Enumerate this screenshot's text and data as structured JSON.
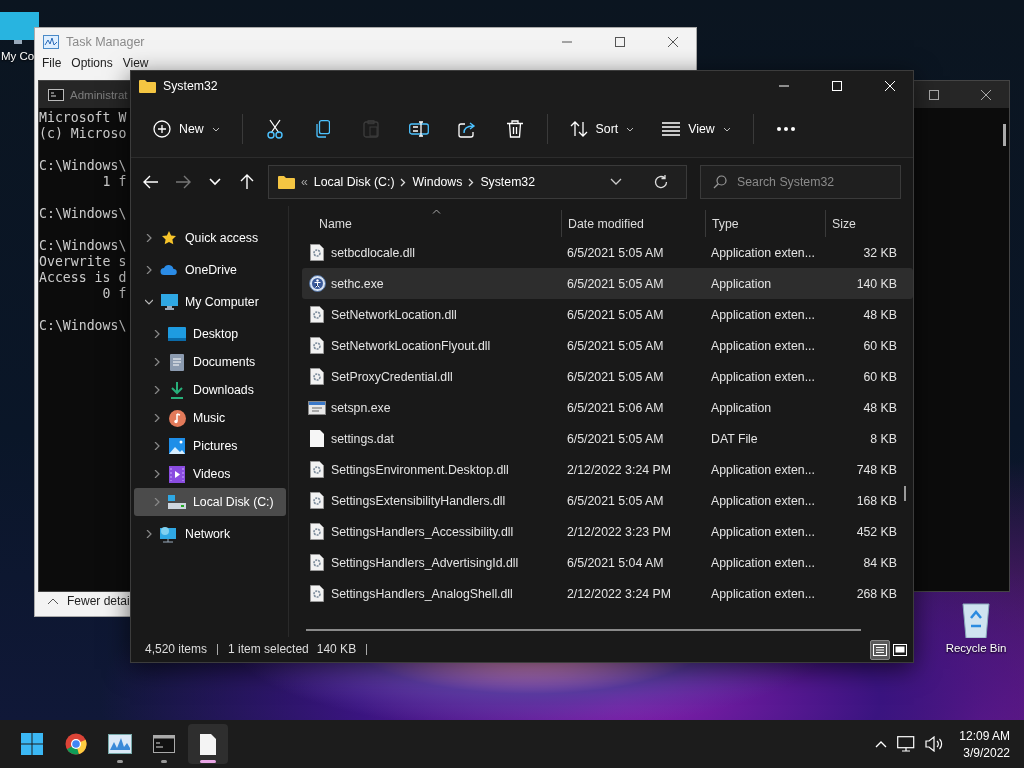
{
  "desktop_icons": [
    {
      "kind": "computer",
      "label": "My Co"
    },
    {
      "kind": "recycle_bin",
      "label": "Recycle Bin"
    }
  ],
  "task_manager": {
    "title": "Task Manager",
    "menu": [
      "File",
      "Options",
      "View"
    ],
    "footer_button": "Fewer detai"
  },
  "command_prompt": {
    "title": "Administrat",
    "blocks": [
      [
        "Microsoft W",
        "(c) Microso"
      ],
      [
        "C:\\Windows\\",
        "        1 f"
      ],
      [
        "C:\\Windows\\"
      ],
      [
        "C:\\Windows\\",
        "Overwrite s",
        "Access is d",
        "        0 f"
      ],
      [
        "C:\\Windows\\"
      ]
    ]
  },
  "explorer": {
    "title": "System32",
    "toolbar": [
      {
        "kind": "new",
        "label": "New",
        "disabled": false
      },
      {
        "kind": "separator"
      },
      {
        "kind": "cut",
        "disabled": false
      },
      {
        "kind": "copy",
        "disabled": false
      },
      {
        "kind": "paste",
        "disabled": true
      },
      {
        "kind": "rename",
        "disabled": false
      },
      {
        "kind": "share",
        "disabled": false
      },
      {
        "kind": "delete",
        "disabled": false
      },
      {
        "kind": "separator"
      },
      {
        "kind": "sort",
        "label": "Sort",
        "disabled": false
      },
      {
        "kind": "view",
        "label": "View",
        "disabled": false
      },
      {
        "kind": "separator"
      },
      {
        "kind": "more",
        "disabled": false
      }
    ],
    "nav_buttons": [
      {
        "kind": "back",
        "disabled": false
      },
      {
        "kind": "forward",
        "disabled": true
      },
      {
        "kind": "recent",
        "disabled": false
      },
      {
        "kind": "up",
        "disabled": false
      }
    ],
    "address": {
      "overflow": "«",
      "crumbs": [
        "Local Disk (C:)",
        "Windows",
        "System32"
      ]
    },
    "search": {
      "placeholder": "Search System32"
    },
    "nav_pane": [
      {
        "kind": "quick_access",
        "label": "Quick access",
        "expanded": false,
        "selected": false
      },
      {
        "kind": "onedrive",
        "label": "OneDrive",
        "expanded": false,
        "selected": false
      },
      {
        "kind": "computer",
        "label": "My Computer",
        "expanded": true,
        "selected": false,
        "children": [
          {
            "kind": "desktop",
            "label": "Desktop",
            "expanded": false,
            "selected": false
          },
          {
            "kind": "documents",
            "label": "Documents",
            "expanded": false,
            "selected": false
          },
          {
            "kind": "downloads",
            "label": "Downloads",
            "expanded": false,
            "selected": false
          },
          {
            "kind": "music",
            "label": "Music",
            "expanded": false,
            "selected": false
          },
          {
            "kind": "pictures",
            "label": "Pictures",
            "expanded": false,
            "selected": false
          },
          {
            "kind": "videos",
            "label": "Videos",
            "expanded": false,
            "selected": false
          },
          {
            "kind": "drive",
            "label": "Local Disk (C:)",
            "expanded": false,
            "selected": true
          }
        ]
      },
      {
        "kind": "network",
        "label": "Network",
        "expanded": false,
        "selected": false
      }
    ],
    "columns": [
      {
        "label": "Name",
        "sorted": true
      },
      {
        "label": "Date modified",
        "sorted": false
      },
      {
        "label": "Type",
        "sorted": false
      },
      {
        "label": "Size",
        "sorted": false
      }
    ],
    "rows": [
      {
        "kind": "dll",
        "name": "setbcdlocale.dll",
        "date": "6/5/2021 5:05 AM",
        "type": "Application exten...",
        "size": "32 KB",
        "selected": false
      },
      {
        "kind": "accessibility",
        "name": "sethc.exe",
        "date": "6/5/2021 5:05 AM",
        "type": "Application",
        "size": "140 KB",
        "selected": true
      },
      {
        "kind": "dll",
        "name": "SetNetworkLocation.dll",
        "date": "6/5/2021 5:05 AM",
        "type": "Application exten...",
        "size": "48 KB",
        "selected": false
      },
      {
        "kind": "dll",
        "name": "SetNetworkLocationFlyout.dll",
        "date": "6/5/2021 5:05 AM",
        "type": "Application exten...",
        "size": "60 KB",
        "selected": false
      },
      {
        "kind": "dll",
        "name": "SetProxyCredential.dll",
        "date": "6/5/2021 5:05 AM",
        "type": "Application exten...",
        "size": "60 KB",
        "selected": false
      },
      {
        "kind": "program",
        "name": "setspn.exe",
        "date": "6/5/2021 5:06 AM",
        "type": "Application",
        "size": "48 KB",
        "selected": false
      },
      {
        "kind": "file",
        "name": "settings.dat",
        "date": "6/5/2021 5:05 AM",
        "type": "DAT File",
        "size": "8 KB",
        "selected": false
      },
      {
        "kind": "dll",
        "name": "SettingsEnvironment.Desktop.dll",
        "date": "2/12/2022 3:24 PM",
        "type": "Application exten...",
        "size": "748 KB",
        "selected": false
      },
      {
        "kind": "dll",
        "name": "SettingsExtensibilityHandlers.dll",
        "date": "6/5/2021 5:05 AM",
        "type": "Application exten...",
        "size": "168 KB",
        "selected": false
      },
      {
        "kind": "dll",
        "name": "SettingsHandlers_Accessibility.dll",
        "date": "2/12/2022 3:23 PM",
        "type": "Application exten...",
        "size": "452 KB",
        "selected": false
      },
      {
        "kind": "dll",
        "name": "SettingsHandlers_AdvertisingId.dll",
        "date": "6/5/2021 5:04 AM",
        "type": "Application exten...",
        "size": "84 KB",
        "selected": false
      },
      {
        "kind": "dll",
        "name": "SettingsHandlers_AnalogShell.dll",
        "date": "2/12/2022 3:24 PM",
        "type": "Application exten...",
        "size": "268 KB",
        "selected": false
      }
    ],
    "status": {
      "item_count": "4,520 items",
      "selection": "1 item selected",
      "selection_size": "140 KB"
    },
    "view_modes": [
      {
        "kind": "details",
        "selected": true
      },
      {
        "kind": "tiles",
        "selected": false
      }
    ]
  },
  "taskbar": {
    "apps": [
      {
        "kind": "start",
        "running": false,
        "active": false
      },
      {
        "kind": "browser",
        "running": false,
        "active": false
      },
      {
        "kind": "task_manager",
        "running": true,
        "active": false
      },
      {
        "kind": "terminal",
        "running": true,
        "active": false
      },
      {
        "kind": "file",
        "running": true,
        "active": true
      }
    ],
    "tray": {
      "time": "12:09 AM",
      "date": "3/9/2022"
    }
  }
}
